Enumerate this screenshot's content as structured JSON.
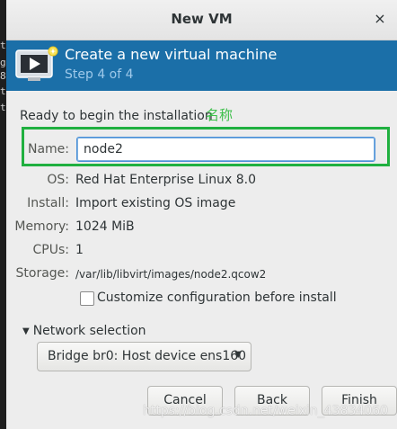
{
  "background_terminal": {
    "glyphs": [
      "t",
      "g",
      "8",
      "t",
      "t"
    ]
  },
  "window": {
    "title": "New VM",
    "close_glyph": "×"
  },
  "banner": {
    "icon": "vm-monitor-icon",
    "title": "Create a new virtual machine",
    "step": "Step 4 of 4",
    "colors": {
      "background": "#1b6fa8",
      "step_text": "#9ec9ea"
    }
  },
  "summary": {
    "heading": "Ready to begin the installation",
    "annotation": "名称",
    "name": {
      "label": "Name:",
      "value": "node2"
    },
    "rows": [
      {
        "label": "OS:",
        "value": "Red Hat Enterprise Linux 8.0"
      },
      {
        "label": "Install:",
        "value": "Import existing OS image"
      },
      {
        "label": "Memory:",
        "value": "1024 MiB"
      },
      {
        "label": "CPUs:",
        "value": "1"
      },
      {
        "label": "Storage:",
        "value": "/var/lib/libvirt/images/node2.qcow2"
      }
    ]
  },
  "customize": {
    "label": "Customize configuration before install",
    "checked": false
  },
  "network": {
    "expander_label": "Network selection",
    "selected": "Bridge br0: Host device ens160"
  },
  "buttons": {
    "cancel": "Cancel",
    "back": "Back",
    "finish": "Finish"
  },
  "watermark": "https://blog.csdn.net/weixin_43834060",
  "colors": {
    "highlight_box": "#20b040",
    "annotation": "#3cbf4a",
    "focus": "#4a90d9"
  }
}
